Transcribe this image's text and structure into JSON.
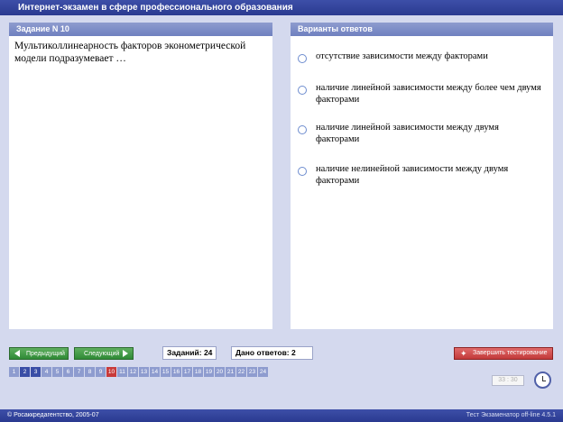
{
  "window": {
    "title": "Интернет-экзамен в сфере профессионального образования"
  },
  "question": {
    "header": "Задание N 10",
    "text": "Мультиколлинеарность факторов эконометрической модели подразумевает …"
  },
  "answers": {
    "header": "Варианты ответов",
    "options": [
      "отсутствие зависимости между факторами",
      "наличие линейной зависимости между более чем двумя факторами",
      "наличие линейной зависимости между двумя факторами",
      "наличие нелинейной зависимости между двумя факторами"
    ]
  },
  "nav": {
    "prev_label": "Предыдущий",
    "next_label": "Следующий"
  },
  "stats": {
    "tasks_label": "Заданий: 24",
    "answered_label": "Дано ответов: 2"
  },
  "finish_label": "Завершить тестирование",
  "pages": [
    "1",
    "2",
    "3",
    "4",
    "5",
    "6",
    "7",
    "8",
    "9",
    "10",
    "11",
    "12",
    "13",
    "14",
    "15",
    "16",
    "17",
    "18",
    "19",
    "20",
    "21",
    "22",
    "23",
    "24"
  ],
  "page_states": {
    "answered": [
      "2",
      "3"
    ],
    "current": "10"
  },
  "timer": "33 : 30",
  "footer": {
    "left": "© Росаккредагентство, 2005-07",
    "right": "Тест Экзаменатор off-line 4.5.1"
  },
  "colors": {
    "accent": "#2a3a90",
    "current_page": "#c83a3a",
    "nav_button": "#2f8a36",
    "finish_button": "#c23a3a"
  },
  "icons": {
    "prev": "triangle-left-icon",
    "next": "triangle-right-icon",
    "finish": "running-man-icon",
    "clock": "clock-icon"
  }
}
